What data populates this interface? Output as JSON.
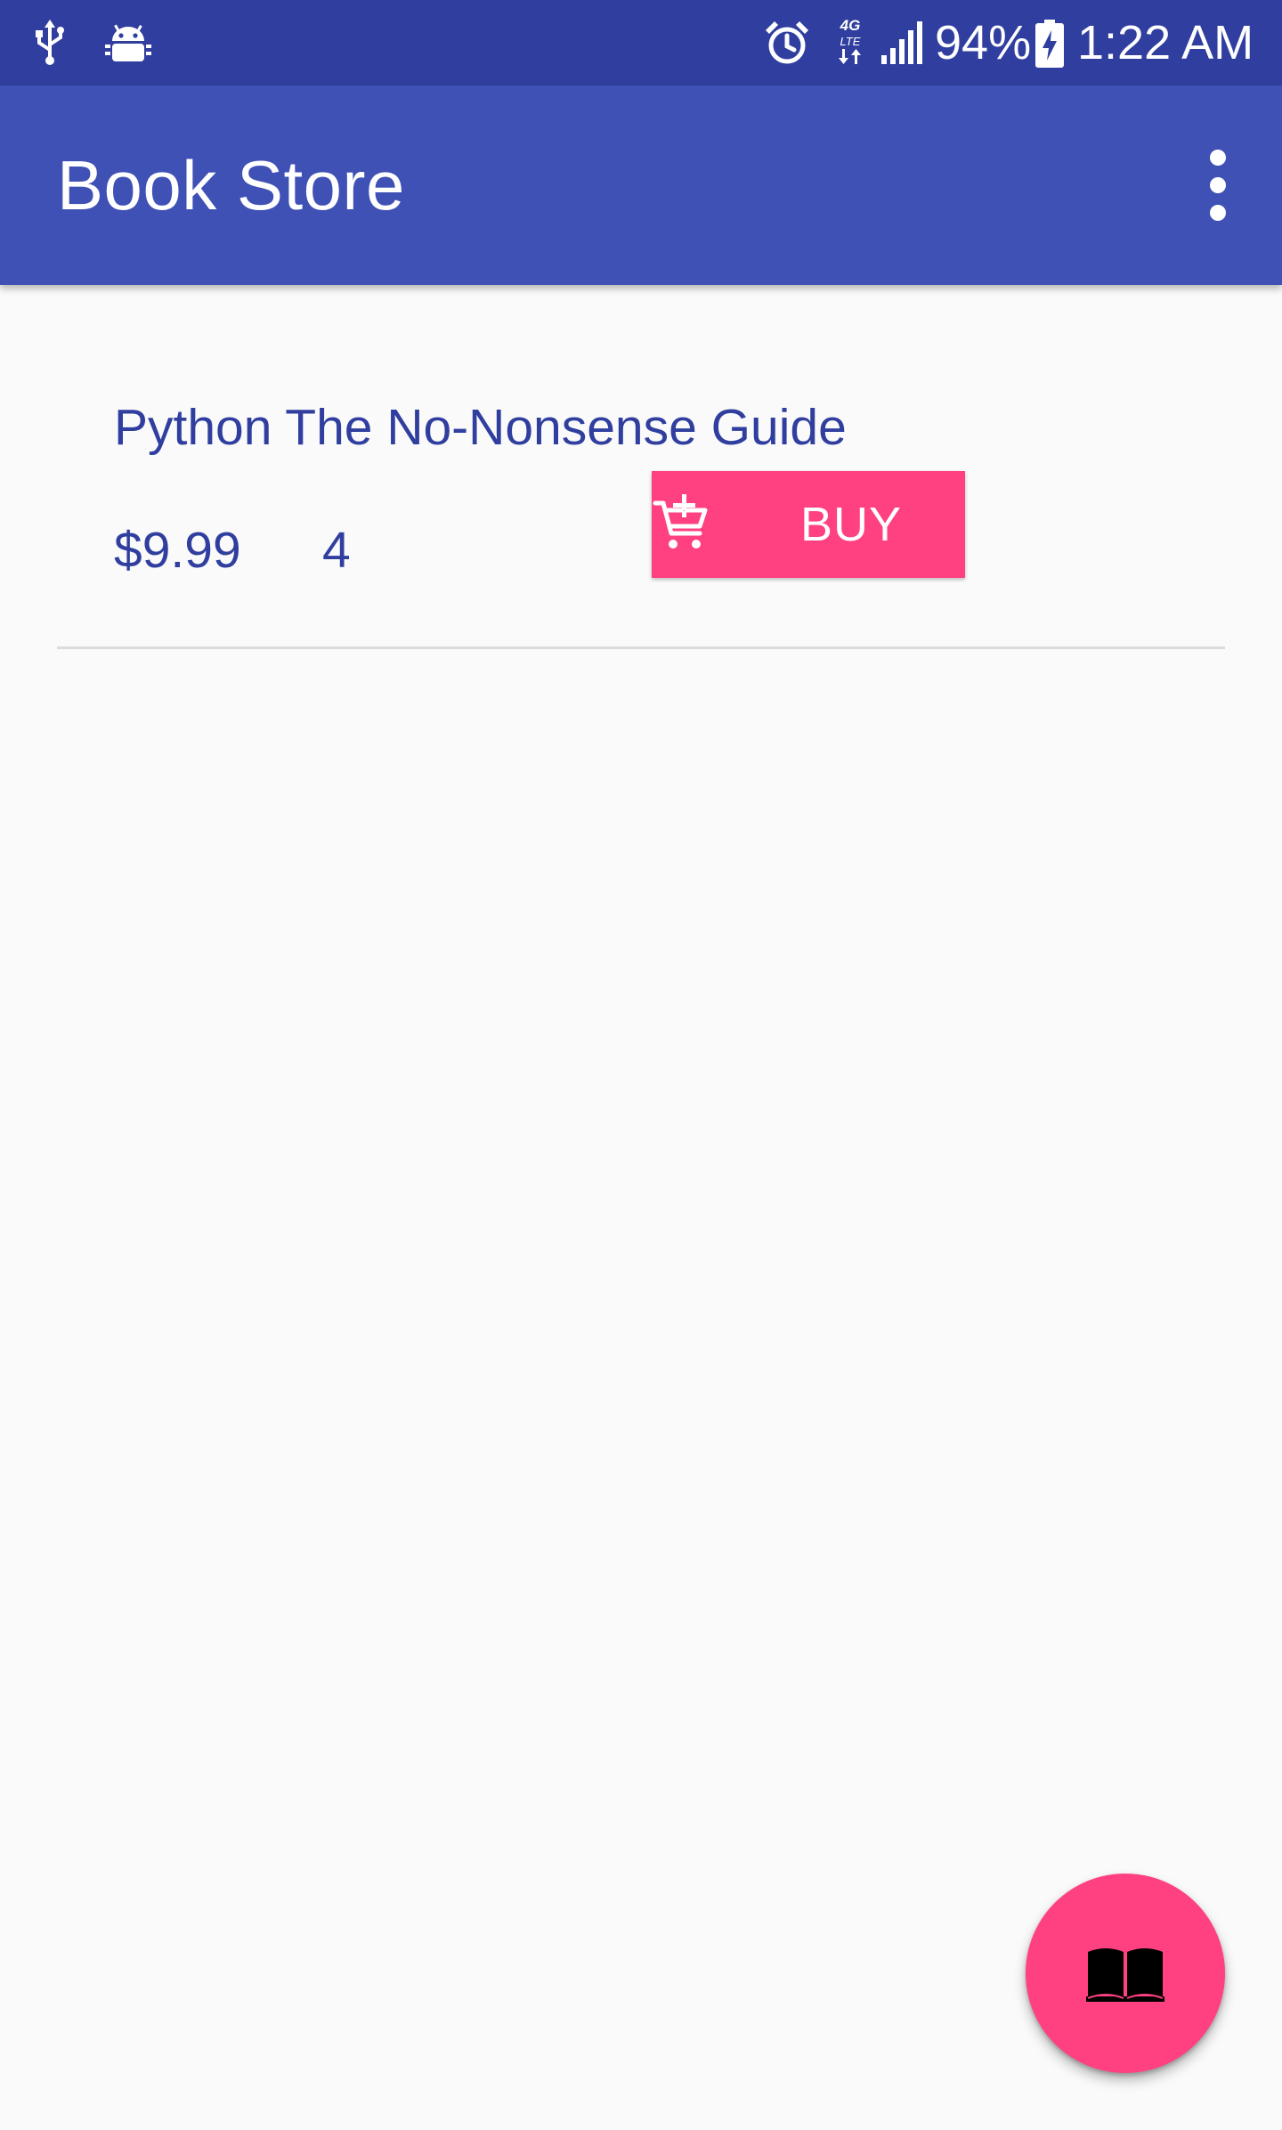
{
  "status_bar": {
    "left_icons": [
      "usb-icon",
      "android-debug-icon"
    ],
    "right_icons": [
      "alarm-icon",
      "network-4g-lte-icon",
      "signal-icon",
      "battery-charging-icon"
    ],
    "battery_percent_text": "94%",
    "time": "1:22 AM",
    "background_color": "#303f9f"
  },
  "app_bar": {
    "title": "Book Store",
    "menu_icon": "more-vertical-icon",
    "background_color": "#3f51b5"
  },
  "book_list": {
    "items": [
      {
        "title": "Python The No-Nonsense Guide",
        "price": "$9.99",
        "quantity": "4",
        "buy_label": "BUY",
        "buy_icon": "add-shopping-cart-icon"
      }
    ],
    "text_color": "#303f9f",
    "accent_color": "#ff4081"
  },
  "fab": {
    "icon": "book-open-icon",
    "background_color": "#ff4081"
  }
}
